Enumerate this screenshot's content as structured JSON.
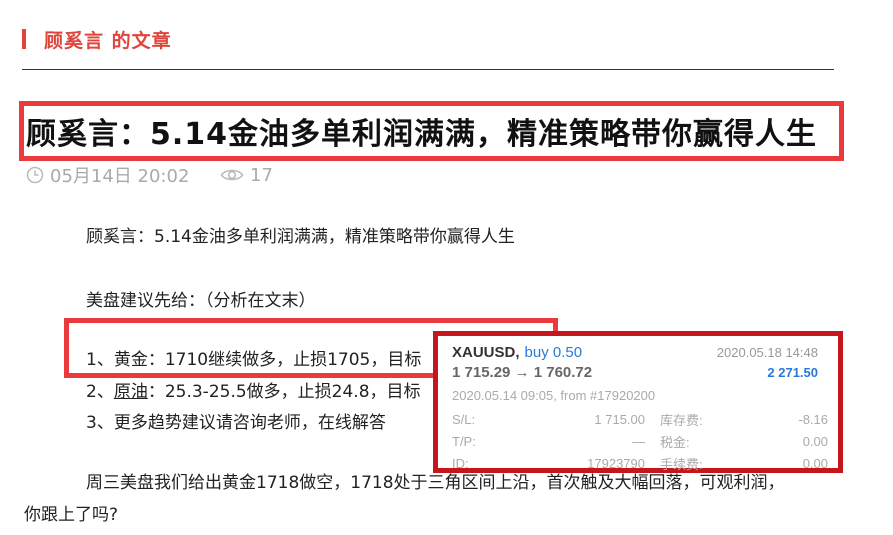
{
  "section": {
    "title": "顾奚言 的文章"
  },
  "article": {
    "title": "顾奚言：5.14金油多单利润满满，精准策略带你赢得人生",
    "date": "05月14日 20:02",
    "views": "17",
    "intro": "顾奚言：5.14金油多单利润满满，精准策略带你赢得人生",
    "advice_heading": "美盘建议先给：（分析在文末）",
    "items": [
      {
        "prefix": "1、黄金：",
        "text": "1710继续做多，止损1705，目标"
      },
      {
        "prefix": "2、",
        "link": "原油",
        "text": "：25.3-25.5做多，止损24.8，目标"
      },
      {
        "prefix": "3、",
        "text": "更多趋势建议请咨询老师，在线解答"
      }
    ],
    "para_line1": "周三美盘我们给出黄金1718做空，1718处于三角区间上沿，首次触及大幅回落，可观利润，",
    "para_line2": "你跟上了吗?"
  },
  "trade_card": {
    "symbol": "XAUUSD,",
    "side": "buy 0.50",
    "close_time": "2020.05.18 14:48",
    "prices": "1 715.29 → 1 760.72",
    "profit": "2 271.50",
    "open_info": "2020.05.14 09:05, from #17920200",
    "rows": [
      {
        "k1": "S/L:",
        "v1": "1 715.00",
        "k2": "库存费:",
        "v2": "-8.16"
      },
      {
        "k1": "T/P:",
        "v1": "—",
        "k2": "税金:",
        "v2": "0.00"
      },
      {
        "k1": "ID:",
        "v1": "17923790",
        "k2": "手续费:",
        "v2": "0.00"
      }
    ]
  },
  "icons": {
    "clock": "clock-icon",
    "eye": "eye-icon"
  },
  "colors": {
    "accent": "#e0453c",
    "highlight_border": "#ea3a3e",
    "card_border": "#c4161c",
    "link_blue": "#2979d9"
  }
}
